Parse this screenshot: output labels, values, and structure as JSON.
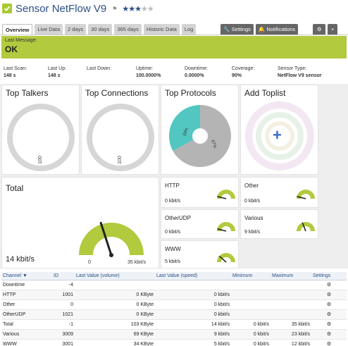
{
  "header": {
    "title": "Sensor NetFlow V9",
    "flag": "⚑",
    "stars_on": "★★★",
    "stars_off": "★★"
  },
  "tabs": [
    "Overview",
    "Live Data",
    "2 days",
    "30 days",
    "365 days",
    "Historic Data",
    "Log"
  ],
  "tabs_right": {
    "settings": "Settings",
    "notifications": "Notifications"
  },
  "status": {
    "label": "Last Message:",
    "value": "OK",
    "color": "#b1ca3e"
  },
  "stats": [
    {
      "label": "Last Scan:",
      "value": "148 s"
    },
    {
      "label": "Last Up:",
      "value": "148 s"
    },
    {
      "label": "Last Down:",
      "value": ""
    },
    {
      "label": "Uptime:",
      "value": "100.0000%"
    },
    {
      "label": "Downtime:",
      "value": "0.0000%"
    },
    {
      "label": "Coverage:",
      "value": "90%"
    },
    {
      "label": "Sensor Type:",
      "value": "NetFlow V9 sensor"
    }
  ],
  "panels": {
    "top_talkers": {
      "title": "Top Talkers",
      "label": "100"
    },
    "top_connections": {
      "title": "Top Connections",
      "label": "100"
    },
    "top_protocols": {
      "title": "Top Protocols",
      "slice_a": "33%",
      "slice_b": "67%",
      "fraction_a": 0.33,
      "colors": [
        "#52c6c1",
        "#b4b4b4"
      ]
    },
    "add_toplist": {
      "title": "Add Toplist",
      "plus": "+"
    }
  },
  "total": {
    "title": "Total",
    "value": "14 kbit/s",
    "min": "0",
    "max": "35 kbit/s",
    "fraction": 0.4,
    "color": "#b1ca3e"
  },
  "small_gauges": [
    {
      "title": "HTTP",
      "value": "0 kbit/s",
      "fraction": 0.0
    },
    {
      "title": "Other",
      "value": "0 kbit/s",
      "fraction": 0.0
    },
    {
      "title": "OtherUDP",
      "value": "0 kbit/s",
      "fraction": 0.0
    },
    {
      "title": "Various",
      "value": "9 kbit/s",
      "fraction": 0.3
    },
    {
      "title": "WWW",
      "value": "5 kbit/s",
      "fraction": 0.15
    }
  ],
  "table": {
    "headers": [
      "Channel ▼",
      "ID",
      "Last Value (volume)",
      "Last Value (speed)",
      "Minimum",
      "Maximum",
      "Settings"
    ],
    "rows": [
      [
        "Downtime",
        "-4",
        "",
        "",
        "",
        "",
        "⚙"
      ],
      [
        "HTTP",
        "1001",
        "0 KByte",
        "0 kbit/s",
        "",
        "",
        "⚙"
      ],
      [
        "Other",
        "0",
        "0 KByte",
        "0 kbit/s",
        "",
        "",
        "⚙"
      ],
      [
        "OtherUDP",
        "1021",
        "0 KByte",
        "0 kbit/s",
        "",
        "",
        "⚙"
      ],
      [
        "Total",
        "-1",
        "103 KByte",
        "14 kbit/s",
        "0 kbit/s",
        "35 kbit/s",
        "⚙"
      ],
      [
        "Various",
        "3009",
        "69 KByte",
        "9 kbit/s",
        "0 kbit/s",
        "23 kbit/s",
        "⚙"
      ],
      [
        "WWW",
        "3001",
        "34 KByte",
        "5 kbit/s",
        "0 kbit/s",
        "12 kbit/s",
        "⚙"
      ]
    ]
  }
}
